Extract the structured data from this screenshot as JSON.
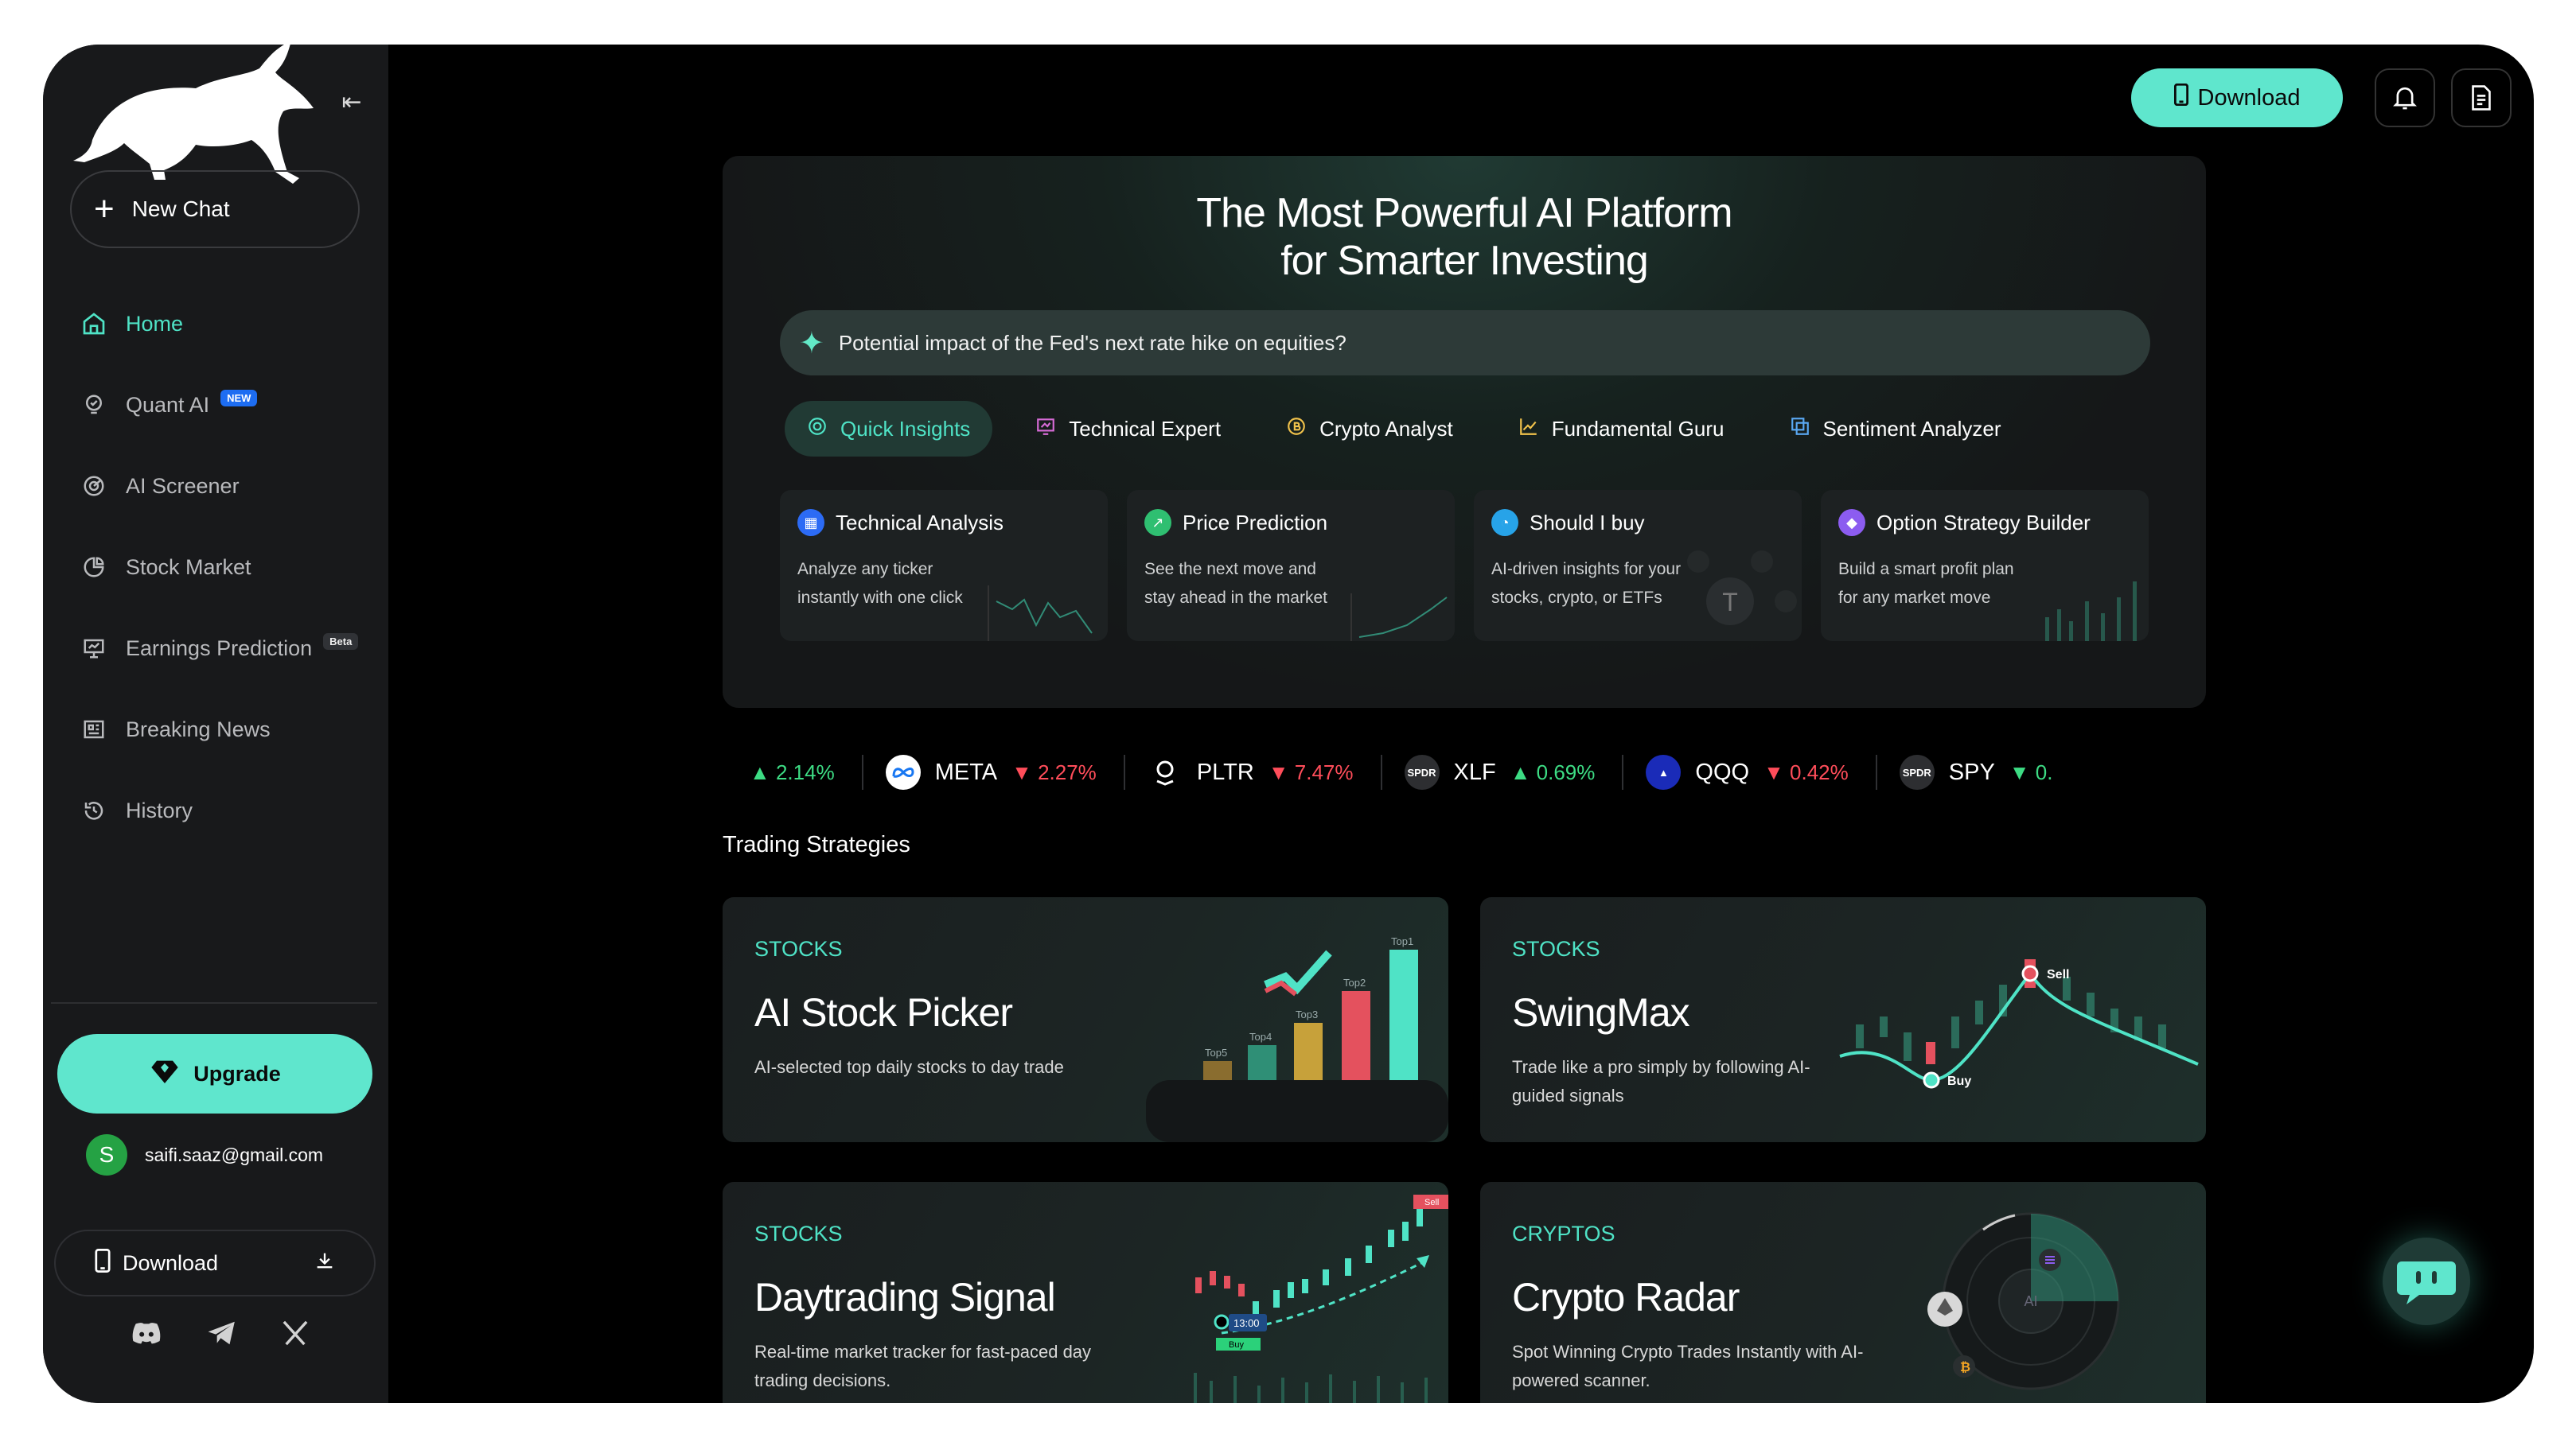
{
  "sidebar": {
    "new_chat": "New Chat",
    "nav": [
      {
        "label": "Home",
        "icon": "home-icon",
        "active": true
      },
      {
        "label": "Quant AI",
        "icon": "bulb-icon",
        "badge": "NEW"
      },
      {
        "label": "AI Screener",
        "icon": "radar-icon"
      },
      {
        "label": "Stock Market",
        "icon": "pie-icon"
      },
      {
        "label": "Earnings Prediction",
        "icon": "presentation-icon",
        "badge": "Beta"
      },
      {
        "label": "Breaking News",
        "icon": "news-icon"
      },
      {
        "label": "History",
        "icon": "history-icon"
      }
    ],
    "upgrade": "Upgrade",
    "user_initial": "S",
    "user_email": "saifi.saaz@gmail.com",
    "download": "Download"
  },
  "header": {
    "download": "Download"
  },
  "hero": {
    "title_line1": "The Most Powerful AI Platform",
    "title_line2": "for Smarter Investing",
    "prompt": "Potential impact of the Fed's next rate hike on equities?",
    "tabs": [
      "Quick Insights",
      "Technical Expert",
      "Crypto Analyst",
      "Fundamental Guru",
      "Sentiment Analyzer"
    ],
    "cards": [
      {
        "title": "Technical Analysis",
        "desc": "Analyze any ticker instantly with one click",
        "color": "#2c6bf5"
      },
      {
        "title": "Price Prediction",
        "desc": "See the next move and stay ahead in the market",
        "color": "#2fbf71"
      },
      {
        "title": "Should I buy",
        "desc": "AI-driven insights for your stocks, crypto, or ETFs",
        "color": "#27a3e8"
      },
      {
        "title": "Option Strategy Builder",
        "desc": "Build a smart profit plan for any market move",
        "color": "#8c5cf0"
      }
    ]
  },
  "ticker": [
    {
      "symbol": "",
      "change": "2.14%",
      "dir": "up"
    },
    {
      "symbol": "META",
      "change": "2.27%",
      "dir": "down"
    },
    {
      "symbol": "PLTR",
      "change": "7.47%",
      "dir": "down"
    },
    {
      "symbol": "XLF",
      "change": "0.69%",
      "dir": "up"
    },
    {
      "symbol": "QQQ",
      "change": "0.42%",
      "dir": "down"
    },
    {
      "symbol": "SPY",
      "change": "0.",
      "dir": "up"
    }
  ],
  "strategies": {
    "heading": "Trading Strategies",
    "cards": [
      {
        "category": "STOCKS",
        "title": "AI Stock Picker",
        "desc": "AI-selected top daily stocks to day trade"
      },
      {
        "category": "STOCKS",
        "title": "SwingMax",
        "desc": "Trade like a pro simply by following AI-guided signals"
      },
      {
        "category": "STOCKS",
        "title": "Daytrading Signal",
        "desc": "Real-time market tracker for fast-paced day trading decisions."
      },
      {
        "category": "CRYPTOS",
        "title": "Crypto Radar",
        "desc": "Spot Winning Crypto Trades Instantly with AI-powered scanner."
      }
    ],
    "chart_labels": {
      "top1": "Top1",
      "top2": "Top2",
      "top3": "Top3",
      "top4": "Top4",
      "top5": "Top5",
      "sell": "Sell",
      "buy": "Buy",
      "time": "13:00",
      "ai": "AI"
    }
  },
  "colors": {
    "accent": "#5fe6cd",
    "up": "#3ddc84",
    "down": "#ff4d5a"
  }
}
